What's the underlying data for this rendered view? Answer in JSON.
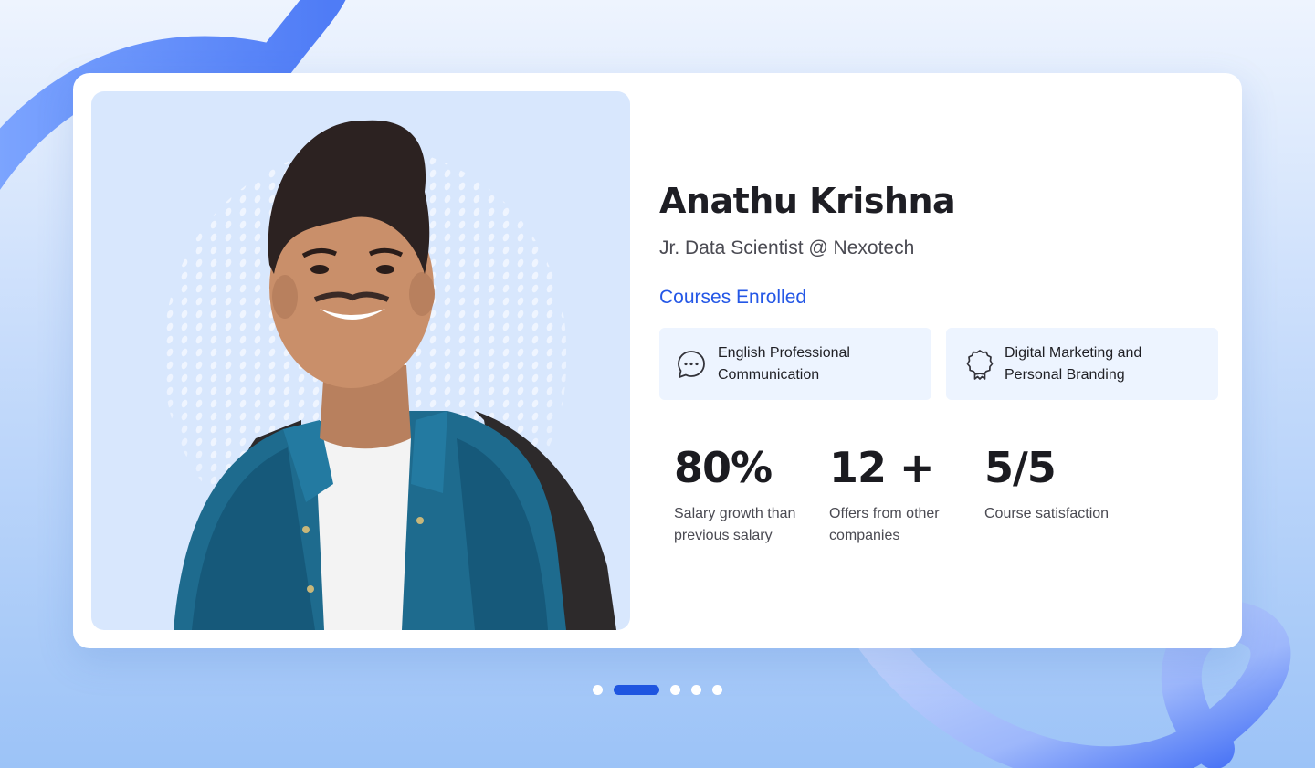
{
  "profile": {
    "name": "Anathu Krishna",
    "role": "Jr. Data Scientist @ Nexotech"
  },
  "courses": {
    "title": "Courses Enrolled",
    "items": [
      {
        "line1": "English Professional",
        "line2": "Communication",
        "icon": "chat-bubble-icon"
      },
      {
        "line1": "Digital Marketing and",
        "line2": "Personal Branding",
        "icon": "award-badge-icon"
      }
    ]
  },
  "stats": [
    {
      "value": "80%",
      "line1": "Salary growth than",
      "line2": "previous salary"
    },
    {
      "value": "12 +",
      "line1": "Offers from other",
      "line2": "companies"
    },
    {
      "value": "5/5",
      "line1": "Course satisfaction",
      "line2": ""
    }
  ],
  "carousel": {
    "total": 5,
    "active_index": 1
  },
  "colors": {
    "accent": "#2457e6",
    "card_bg": "#ffffff",
    "course_bg": "#edf4ff",
    "photo_bg": "#d8e7fd",
    "text_dark": "#1e1e24"
  }
}
